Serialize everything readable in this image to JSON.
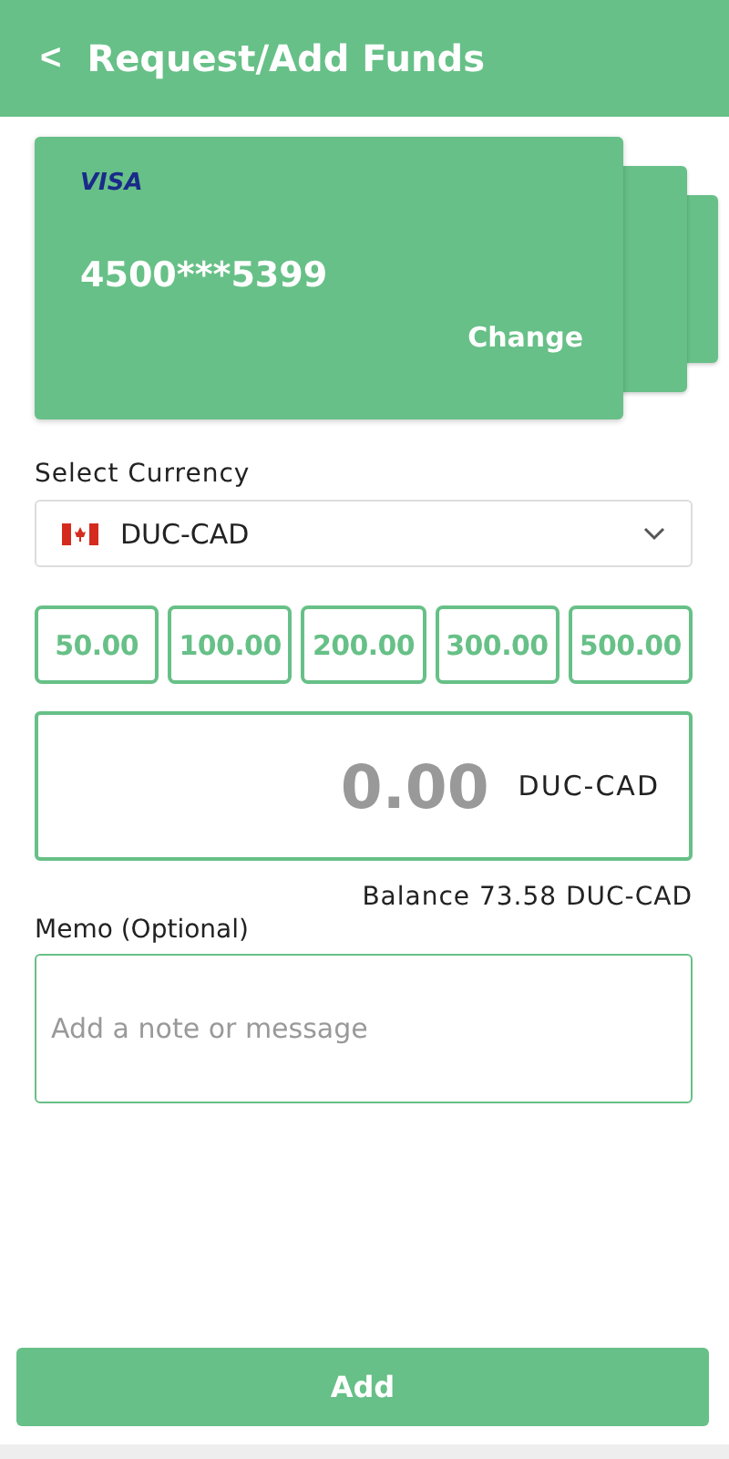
{
  "header": {
    "back_icon": "<",
    "title": "Request/Add Funds"
  },
  "card": {
    "brand": "VISA",
    "number": "4500***5399",
    "action": "Change"
  },
  "currency": {
    "label": "Select Currency",
    "value": "DUC-CAD"
  },
  "amount_options": [
    {
      "label": "50.00"
    },
    {
      "label": "100.00"
    },
    {
      "label": "200.00"
    },
    {
      "label": "300.00"
    },
    {
      "label": "500.00"
    }
  ],
  "amount": {
    "value": "0.00",
    "unit": "DUC-CAD"
  },
  "balance": "Balance 73.58 DUC-CAD",
  "memo": {
    "label": "Memo (Optional)",
    "placeholder": "Add a note or message"
  },
  "submit": "Add"
}
